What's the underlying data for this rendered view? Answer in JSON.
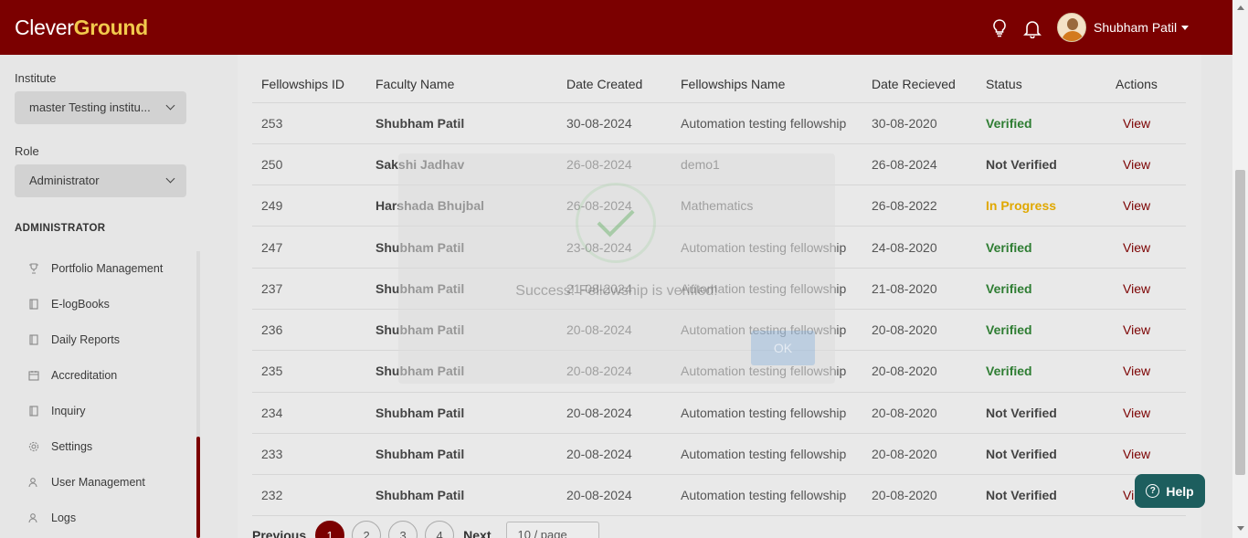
{
  "header": {
    "logo_part1": "Clever",
    "logo_part2": "Ground",
    "user_name": "Shubham Patil",
    "icons": [
      "lightbulb-icon",
      "bell-icon"
    ],
    "bg_color": "#7b0000"
  },
  "sidebar": {
    "institute_label": "Institute",
    "institute_value": "master Testing institu...",
    "role_label": "Role",
    "role_value": "Administrator",
    "section_heading": "ADMINISTRATOR",
    "items": [
      {
        "label": "Portfolio Management",
        "icon": "trophy-icon"
      },
      {
        "label": "E-logBooks",
        "icon": "book-icon"
      },
      {
        "label": "Daily Reports",
        "icon": "book-icon"
      },
      {
        "label": "Accreditation",
        "icon": "calendar-icon"
      },
      {
        "label": "Inquiry",
        "icon": "book-icon"
      },
      {
        "label": "Settings",
        "icon": "gear-icon"
      },
      {
        "label": "User Management",
        "icon": "users-icon"
      },
      {
        "label": "Logs",
        "icon": "users-icon"
      }
    ]
  },
  "table": {
    "headers": [
      "Fellowships ID",
      "Faculty Name",
      "Date Created",
      "Fellowships Name",
      "Date Recieved",
      "Status",
      "Actions"
    ],
    "rows": [
      {
        "id": "253",
        "faculty": "Shubham Patil",
        "created": "30-08-2024",
        "name": "Automation testing fellowship",
        "received": "30-08-2020",
        "status": "Verified",
        "action": "View"
      },
      {
        "id": "250",
        "faculty": "Sakshi Jadhav",
        "created": "26-08-2024",
        "name": "demo1",
        "received": "26-08-2024",
        "status": "Not Verified",
        "action": "View"
      },
      {
        "id": "249",
        "faculty": "Harshada Bhujbal",
        "created": "26-08-2024",
        "name": "Mathematics",
        "received": "26-08-2022",
        "status": "In Progress",
        "action": "View"
      },
      {
        "id": "247",
        "faculty": "Shubham Patil",
        "created": "23-08-2024",
        "name": "Automation testing fellowship",
        "received": "24-08-2020",
        "status": "Verified",
        "action": "View"
      },
      {
        "id": "237",
        "faculty": "Shubham Patil",
        "created": "21-08-2024",
        "name": "Automation testing fellowship",
        "received": "21-08-2020",
        "status": "Verified",
        "action": "View"
      },
      {
        "id": "236",
        "faculty": "Shubham Patil",
        "created": "20-08-2024",
        "name": "Automation testing fellowship",
        "received": "20-08-2020",
        "status": "Verified",
        "action": "View"
      },
      {
        "id": "235",
        "faculty": "Shubham Patil",
        "created": "20-08-2024",
        "name": "Automation testing fellowship",
        "received": "20-08-2020",
        "status": "Verified",
        "action": "View"
      },
      {
        "id": "234",
        "faculty": "Shubham Patil",
        "created": "20-08-2024",
        "name": "Automation testing fellowship",
        "received": "20-08-2020",
        "status": "Not Verified",
        "action": "View"
      },
      {
        "id": "233",
        "faculty": "Shubham Patil",
        "created": "20-08-2024",
        "name": "Automation testing fellowship",
        "received": "20-08-2020",
        "status": "Not Verified",
        "action": "View"
      },
      {
        "id": "232",
        "faculty": "Shubham Patil",
        "created": "20-08-2024",
        "name": "Automation testing fellowship",
        "received": "20-08-2020",
        "status": "Not Verified",
        "action": "Vi"
      }
    ]
  },
  "pagination": {
    "previous": "Previous",
    "pages": [
      "1",
      "2",
      "3",
      "4"
    ],
    "active_page": "1",
    "next": "Next",
    "page_size": "10 / page"
  },
  "modal": {
    "message": "Success! Fellowship is verified!",
    "ok_label": "OK"
  },
  "help": {
    "label": "Help"
  },
  "colors": {
    "verified": "#2e7d32",
    "in_progress": "#e0a800",
    "link": "#7b0000"
  }
}
